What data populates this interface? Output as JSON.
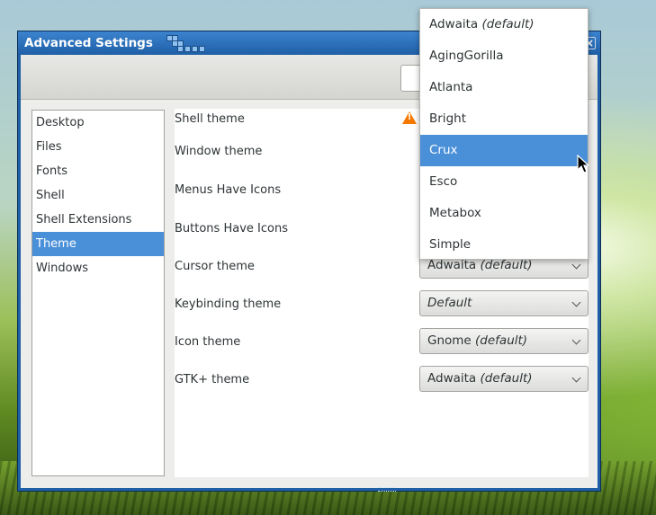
{
  "window": {
    "title": "Advanced Settings",
    "close_label": "×"
  },
  "sidebar": {
    "items": [
      {
        "label": "Desktop"
      },
      {
        "label": "Files"
      },
      {
        "label": "Fonts"
      },
      {
        "label": "Shell"
      },
      {
        "label": "Shell Extensions"
      },
      {
        "label": "Theme",
        "selected": true
      },
      {
        "label": "Windows"
      }
    ]
  },
  "settings": {
    "shell_theme": {
      "label": "Shell theme",
      "warning_mark": "!"
    },
    "window_theme": {
      "label": "Window theme"
    },
    "menus_have_icons": {
      "label": "Menus Have Icons"
    },
    "buttons_have_icons": {
      "label": "Buttons Have Icons"
    },
    "cursor_theme": {
      "label": "Cursor theme",
      "value": "Adwaita",
      "value_suffix": "(default)"
    },
    "keybinding_theme": {
      "label": "Keybinding theme",
      "value": "Default"
    },
    "icon_theme": {
      "label": "Icon theme",
      "value": "Gnome",
      "value_suffix": "(default)"
    },
    "gtk_theme": {
      "label": "GTK+ theme",
      "value": "Adwaita",
      "value_suffix": "(default)"
    }
  },
  "dropdown": {
    "options": [
      {
        "label": "Adwaita",
        "suffix": "(default)"
      },
      {
        "label": "AgingGorilla"
      },
      {
        "label": "Atlanta"
      },
      {
        "label": "Bright"
      },
      {
        "label": "Crux",
        "highlighted": true
      },
      {
        "label": "Esco"
      },
      {
        "label": "Metabox"
      },
      {
        "label": "Simple"
      }
    ]
  },
  "colors": {
    "selection": "#4a90d9",
    "titlebar": "#1f5fa6",
    "warning": "#f57900"
  }
}
